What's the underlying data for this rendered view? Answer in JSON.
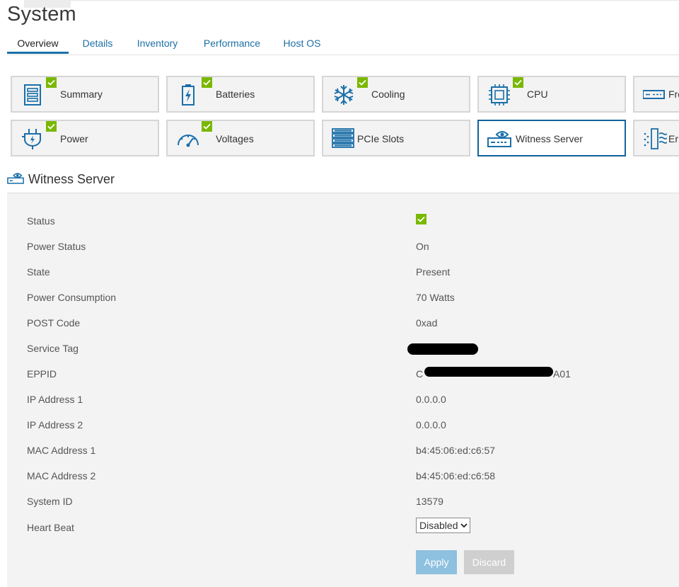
{
  "page": {
    "title": "System"
  },
  "tabs": [
    {
      "label": "Overview",
      "active": true
    },
    {
      "label": "Details"
    },
    {
      "label": "Inventory"
    },
    {
      "label": "Performance"
    },
    {
      "label": "Host OS"
    }
  ],
  "tiles": [
    {
      "label": "Summary",
      "icon": "summary-icon",
      "status": "ok"
    },
    {
      "label": "Batteries",
      "icon": "battery-icon",
      "status": "ok"
    },
    {
      "label": "Cooling",
      "icon": "snowflake-icon",
      "status": "ok"
    },
    {
      "label": "CPU",
      "icon": "cpu-icon",
      "status": "ok"
    },
    {
      "label": "Fro",
      "icon": "front-panel-icon"
    },
    {
      "label": "Power",
      "icon": "plug-icon",
      "status": "ok"
    },
    {
      "label": "Voltages",
      "icon": "gauge-icon",
      "status": "ok"
    },
    {
      "label": "PCIe Slots",
      "icon": "pcie-slots-icon"
    },
    {
      "label": "Witness Server",
      "icon": "witness-server-icon",
      "selected": true
    },
    {
      "label": "Er",
      "icon": "environment-icon"
    }
  ],
  "section": {
    "title": "Witness Server",
    "icon": "witness-server-icon"
  },
  "details": {
    "status": {
      "label": "Status",
      "icon": "check-icon"
    },
    "power_status": {
      "label": "Power Status",
      "value": "On"
    },
    "state": {
      "label": "State",
      "value": "Present"
    },
    "power_consumption": {
      "label": "Power Consumption",
      "value": "70 Watts"
    },
    "post_code": {
      "label": "POST Code",
      "value": "0xad"
    },
    "service_tag": {
      "label": "Service Tag"
    },
    "eppid": {
      "label": "EPPID",
      "value_prefix": "C",
      "value_suffix": "A01"
    },
    "ip1": {
      "label": "IP Address 1",
      "value": "0.0.0.0"
    },
    "ip2": {
      "label": "IP Address 2",
      "value": "0.0.0.0"
    },
    "mac1": {
      "label": "MAC Address 1",
      "value": "b4:45:06:ed:c6:57"
    },
    "mac2": {
      "label": "MAC Address 2",
      "value": "b4:45:06:ed:c6:58"
    },
    "system_id": {
      "label": "System ID",
      "value": "13579"
    },
    "heart_beat": {
      "label": "Heart Beat",
      "selected": "Disabled"
    }
  },
  "buttons": {
    "apply": "Apply",
    "discard": "Discard"
  },
  "colors": {
    "accent": "#1a6fa9",
    "ok_green": "#7ab800",
    "apply_btn": "#8ec0df",
    "discard_btn": "#cfcfcf"
  }
}
